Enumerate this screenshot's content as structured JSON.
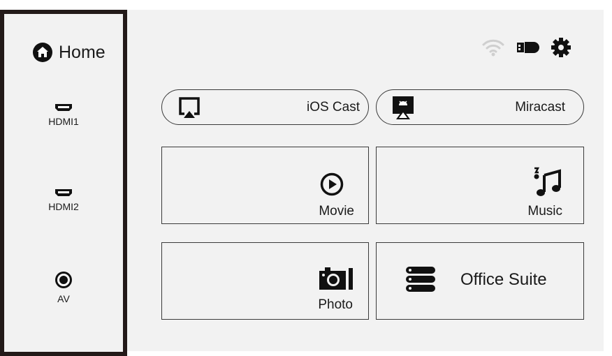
{
  "sidebar": {
    "home": {
      "label": "Home",
      "icon": "home-icon"
    },
    "sources": [
      {
        "label": "HDMI1",
        "icon": "hdmi-port-icon"
      },
      {
        "label": "HDMI2",
        "icon": "hdmi-port-icon"
      },
      {
        "label": "AV",
        "icon": "av-jack-icon"
      }
    ]
  },
  "status_bar": {
    "icons": [
      "wifi-icon",
      "usb-drive-icon",
      "gear-icon"
    ]
  },
  "cast": {
    "ios": {
      "label": "iOS Cast",
      "icon": "airplay-screen-icon"
    },
    "miracast": {
      "label": "Miracast",
      "icon": "android-cast-icon"
    }
  },
  "apps": {
    "movie": {
      "label": "Movie",
      "icon": "play-circle-icon"
    },
    "music": {
      "label": "Music",
      "icon": "music-notes-icon"
    },
    "photo": {
      "label": "Photo",
      "icon": "camera-icon"
    },
    "office": {
      "label": "Office Suite",
      "icon": "stack-list-icon"
    }
  },
  "colors": {
    "background": "#f2f2f2",
    "sidebar_border": "#231a19",
    "icon_dark": "#111111",
    "icon_light": "#cfcfcf"
  }
}
